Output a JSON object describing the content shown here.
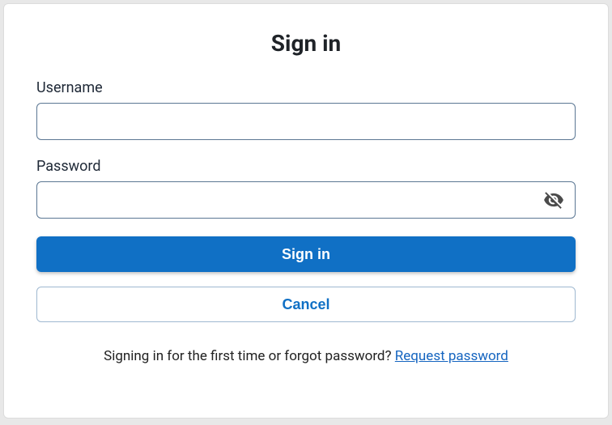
{
  "title": "Sign in",
  "fields": {
    "username": {
      "label": "Username",
      "value": "",
      "placeholder": ""
    },
    "password": {
      "label": "Password",
      "value": "",
      "placeholder": ""
    }
  },
  "buttons": {
    "submit": "Sign in",
    "cancel": "Cancel"
  },
  "footer": {
    "prompt": "Signing in for the first time or forgot password? ",
    "link": "Request password"
  }
}
